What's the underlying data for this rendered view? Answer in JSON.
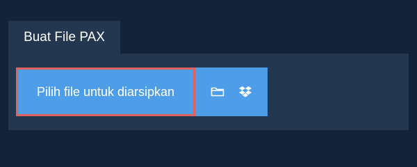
{
  "tab": {
    "label": "Buat File PAX"
  },
  "upload": {
    "choose_label": "Pilih file untuk diarsipkan",
    "icons": [
      "folder-icon",
      "dropbox-icon"
    ]
  },
  "colors": {
    "background": "#13243a",
    "panel": "#233850",
    "button": "#4d9de8",
    "focus_border": "#e0625e",
    "text": "#ffffff"
  }
}
